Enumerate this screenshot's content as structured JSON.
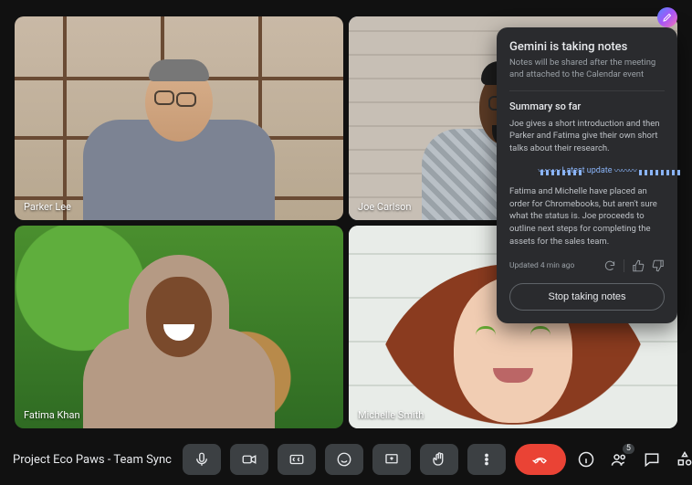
{
  "meeting_name": "Project Eco Paws - Team Sync",
  "participants": [
    {
      "name": "Parker Lee"
    },
    {
      "name": "Joe Carlson"
    },
    {
      "name": "Fatima Khan"
    },
    {
      "name": "Michelle Smith"
    }
  ],
  "participant_count_badge": "5",
  "notes": {
    "title": "Gemini is taking notes",
    "subtitle": "Notes will be shared after the meeting and attached to the Calendar event",
    "summary_heading": "Summary so far",
    "summary_body": "Joe gives a short introduction and then Parker and Fatima give their own short talks about their research.",
    "latest_label": "Latest update",
    "latest_body": "Fatima and Michelle have placed an order for Chromebooks, but aren't sure what the status is. Joe proceeds to outline next steps for completing the assets for the sales team.",
    "updated_text": "Updated 4 min ago",
    "stop_label": "Stop taking notes"
  }
}
